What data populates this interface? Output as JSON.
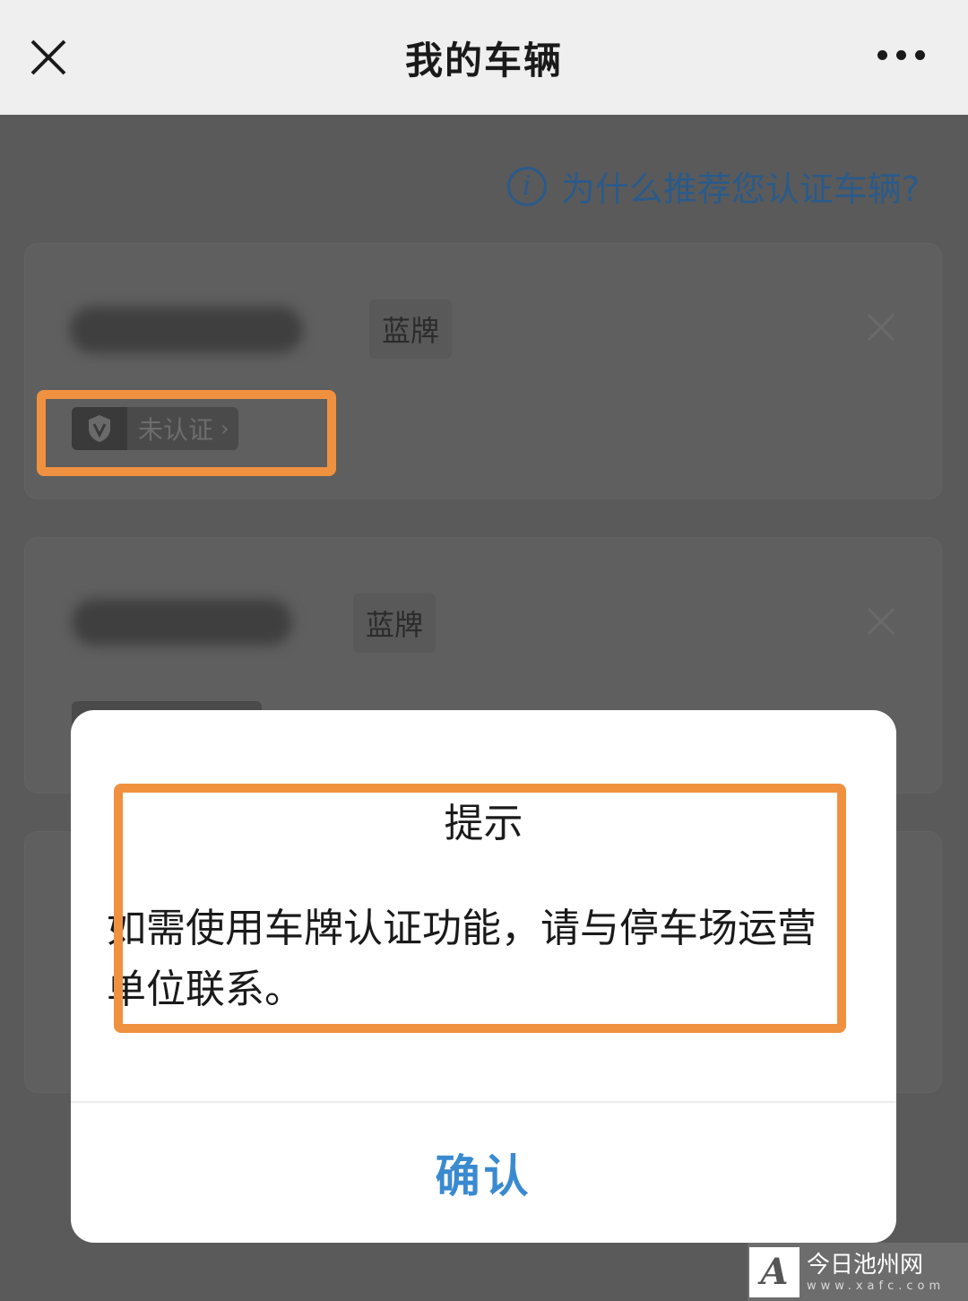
{
  "nav": {
    "title": "我的车辆"
  },
  "help_link": {
    "icon_glyph": "i",
    "label": "为什么推荐您认证车辆?"
  },
  "vehicles": [
    {
      "plate_type": "蓝牌",
      "status": "未认证"
    },
    {
      "plate_type": "蓝牌"
    }
  ],
  "dialog": {
    "title": "提示",
    "message": "如需使用车牌认证功能，请与停车场运营单位联系。",
    "confirm_label": "确认"
  },
  "watermark": {
    "name": "今日池州网",
    "url": "www.xafc.com"
  },
  "colors": {
    "highlight": "#f0913f",
    "link": "#2a5a8a",
    "confirm": "#3a8ad0"
  }
}
